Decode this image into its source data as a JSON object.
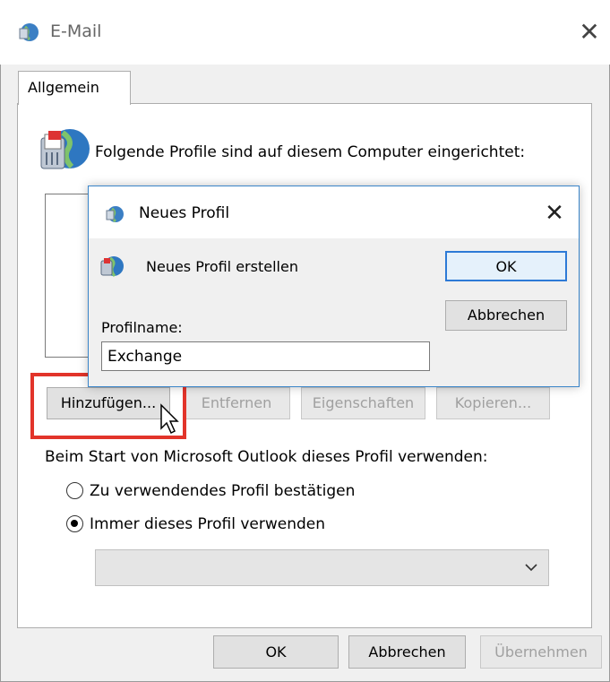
{
  "window": {
    "title": "E-Mail",
    "close_icon": "close-icon"
  },
  "tabs": [
    {
      "label": "Allgemein",
      "selected": true
    }
  ],
  "profiles": {
    "heading": "Folgende Profile sind auf diesem Computer eingerichtet:",
    "items": []
  },
  "profile_buttons": {
    "add": "Hinzufügen...",
    "remove": "Entfernen",
    "properties": "Eigenschaften",
    "copy": "Kopieren..."
  },
  "startup": {
    "label": "Beim Start von Microsoft Outlook dieses Profil verwenden:",
    "option_confirm": "Zu verwendendes Profil bestätigen",
    "option_always": "Immer dieses Profil verwenden",
    "selected_option": "always",
    "selected_profile": ""
  },
  "footer": {
    "ok": "OK",
    "cancel": "Abbrechen",
    "apply": "Übernehmen"
  },
  "dialog": {
    "title": "Neues Profil",
    "heading": "Neues Profil erstellen",
    "ok": "OK",
    "cancel": "Abbrechen",
    "name_label": "Profilname:",
    "name_value": "Exchange"
  },
  "colors": {
    "highlight": "#e2342a",
    "accent": "#2d7ad6"
  }
}
